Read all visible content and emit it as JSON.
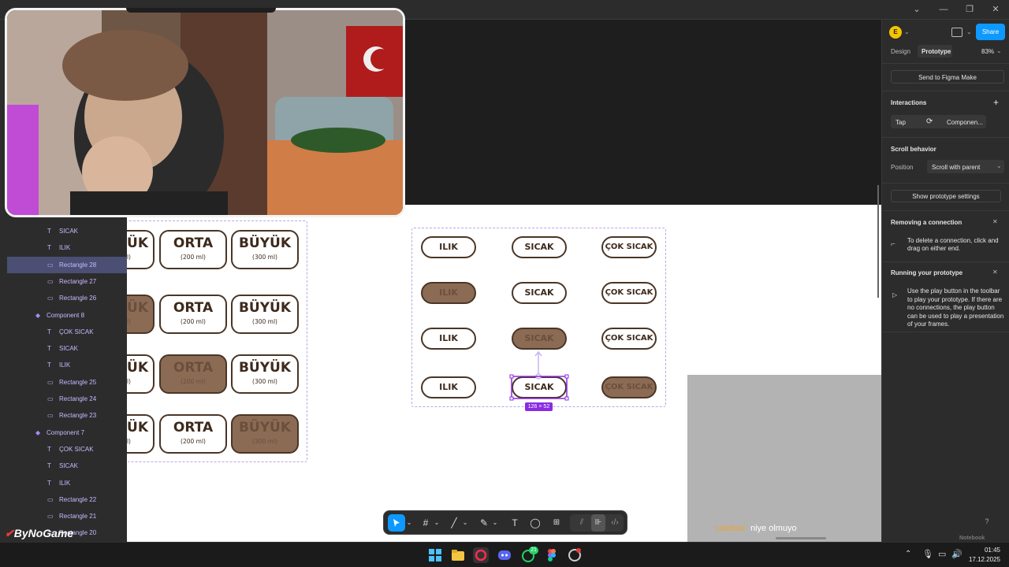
{
  "window": {
    "minimize": "—",
    "restore": "❐",
    "close": "✕",
    "chevron": "⌄"
  },
  "right_panel": {
    "avatar": "E",
    "share": "Share",
    "tabs": [
      "Design",
      "Prototype"
    ],
    "zoom": "83%",
    "send_btn": "Send to Figma Make",
    "interactions_title": "Interactions",
    "interaction_trigger": "Tap",
    "interaction_target": "Componen...",
    "scroll_title": "Scroll behavior",
    "position_label": "Position",
    "position_value": "Scroll with parent",
    "show_settings": "Show prototype settings",
    "removing_title": "Removing a connection",
    "removing_text": "To delete a connection, click and drag on either end.",
    "running_title": "Running your prototype",
    "running_text": "Use the play button in the toolbar to play your prototype. If there are no connections, the play button can be used to play a presentation of your frames."
  },
  "layers": [
    {
      "icon": "T",
      "label": "SICAK",
      "type": "text"
    },
    {
      "icon": "T",
      "label": "ILIK",
      "type": "text"
    },
    {
      "icon": "▭",
      "label": "Rectangle 28",
      "type": "rect",
      "selected": true
    },
    {
      "icon": "▭",
      "label": "Rectangle 27",
      "type": "rect"
    },
    {
      "icon": "▭",
      "label": "Rectangle 26",
      "type": "rect"
    },
    {
      "icon": "◆",
      "label": "Component 8",
      "type": "comp"
    },
    {
      "icon": "T",
      "label": "ÇOK SICAK",
      "type": "text"
    },
    {
      "icon": "T",
      "label": "SICAK",
      "type": "text"
    },
    {
      "icon": "T",
      "label": "ILIK",
      "type": "text"
    },
    {
      "icon": "▭",
      "label": "Rectangle 25",
      "type": "rect"
    },
    {
      "icon": "▭",
      "label": "Rectangle 24",
      "type": "rect"
    },
    {
      "icon": "▭",
      "label": "Rectangle 23",
      "type": "rect"
    },
    {
      "icon": "◆",
      "label": "Component 7",
      "type": "comp"
    },
    {
      "icon": "T",
      "label": "ÇOK SICAK",
      "type": "text"
    },
    {
      "icon": "T",
      "label": "SICAK",
      "type": "text"
    },
    {
      "icon": "T",
      "label": "ILIK",
      "type": "text"
    },
    {
      "icon": "▭",
      "label": "Rectangle 22",
      "type": "rect"
    },
    {
      "icon": "▭",
      "label": "Rectangle 21",
      "type": "rect"
    },
    {
      "icon": "▭",
      "label": "Rectangle 20",
      "type": "rect"
    }
  ],
  "size_frame": {
    "partial": "ÜK",
    "partial_sub": "ml)",
    "rows": [
      {
        "filled": 0
      },
      {
        "filled": 0
      },
      {
        "filled": 1
      },
      {
        "filled": 2
      }
    ],
    "orta": "ORTA",
    "orta_sub": "(200 ml)",
    "buyuk": "BÜYÜK",
    "buyuk_sub": "(300 ml)"
  },
  "temp_frame": {
    "labels": [
      "ILIK",
      "SICAK",
      "ÇOK SICAK"
    ],
    "filled_by_row": [
      -1,
      0,
      1,
      2
    ],
    "size_badge": "126 × 52"
  },
  "toolbar": {
    "text_tool": "T"
  },
  "chat": {
    "user": "catideal",
    "message": "niye olmuyo"
  },
  "watermark": "ByNoGame",
  "notebook": "Notebook",
  "help": "?",
  "taskbar": {
    "time": "01:45",
    "date": "17.12.2025",
    "badge": "21"
  },
  "colors": {
    "accent": "#0d99ff",
    "layer_text": "#c9b8ff",
    "brown_dark": "#4a3526",
    "brown_fill": "#8c6b55",
    "purple_sel": "#8a2be2"
  }
}
